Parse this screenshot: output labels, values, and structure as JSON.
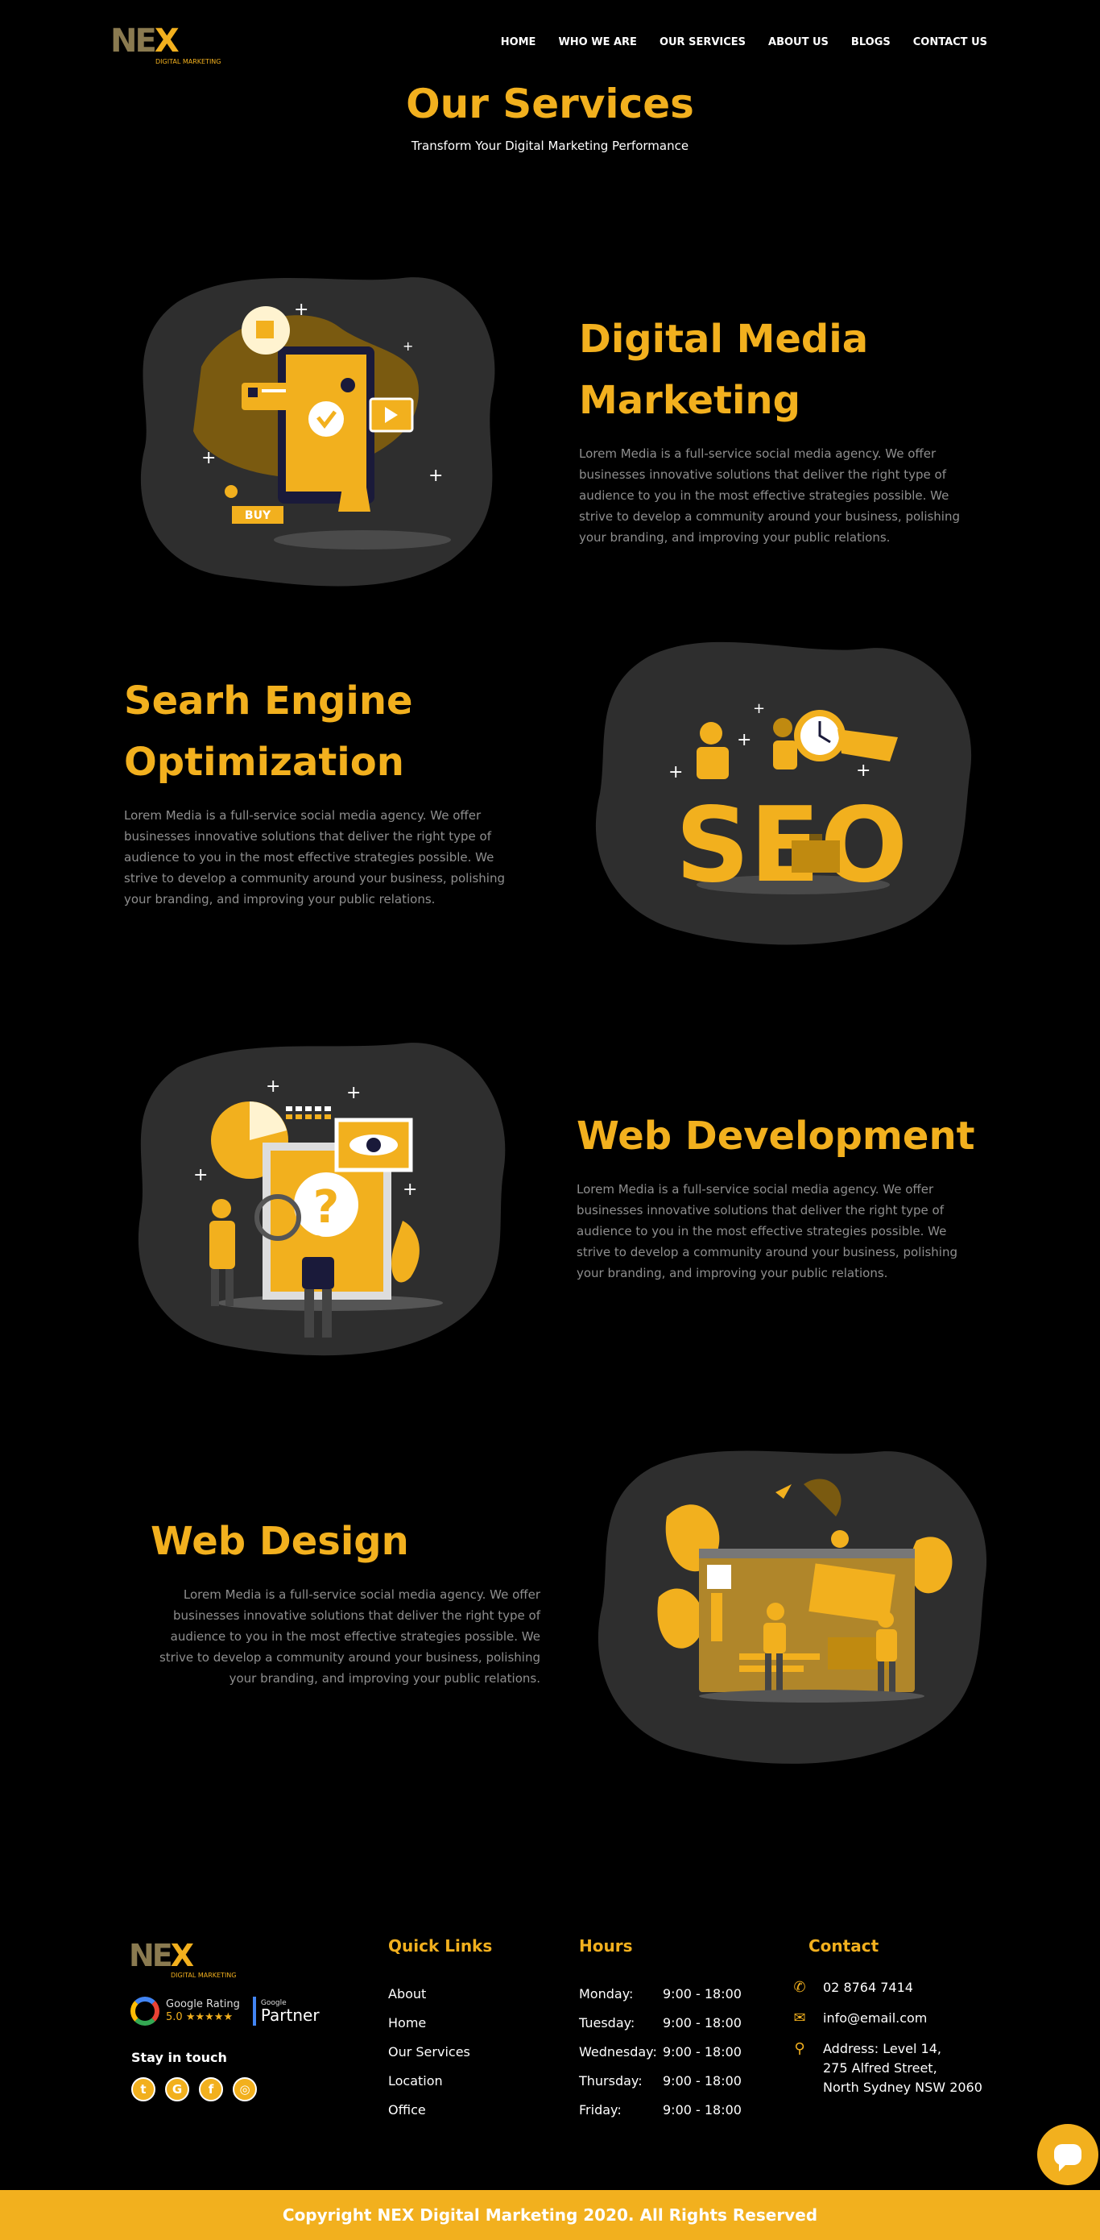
{
  "brand": {
    "logo_text": "NE",
    "logo_x": "X",
    "logo_sub": "DIGITAL MARKETING",
    "accent": "#f2b01e",
    "blob_color": "#2e2e2e"
  },
  "nav": {
    "items": [
      "HOME",
      "WHO WE ARE",
      "OUR SERVICES",
      "ABOUT US",
      "BLOGS",
      "CONTACT US"
    ]
  },
  "hero": {
    "title": "Our Services",
    "subtitle": "Transform Your Digital Marketing Performance"
  },
  "services": [
    {
      "title_line1": "Digital Media",
      "title_line2": "Marketing",
      "description": "Lorem Media is a full-service social media agency. We offer businesses innovative solutions that deliver the right type of audience to you in the most effective strategies possible. We strive to develop a community around your business, polishing your branding, and improving your public relations.",
      "illustration": "phone-marketing-illustration",
      "badge": "BUY"
    },
    {
      "title_line1": "Searh Engine",
      "title_line2": "Optimization",
      "description": "Lorem Media is a full-service social media agency. We offer businesses innovative solutions that deliver the right type of audience to you in the most effective strategies possible. We strive to develop a community around your business, polishing your branding, and improving your public relations.",
      "illustration": "seo-illustration",
      "badge": "SEO"
    },
    {
      "title_line1": "Web Development",
      "description": "Lorem Media is a full-service social media agency. We offer businesses innovative solutions that deliver the right type of audience to you in the most effective strategies possible. We strive to develop a community around your business, polishing your branding, and improving your public relations.",
      "illustration": "web-development-illustration",
      "badge": "?"
    },
    {
      "title_line1": "Web Design",
      "description": "Lorem Media is a full-service social media agency. We offer businesses innovative solutions that deliver the right type of audience to you in the most effective strategies possible. We strive to develop a community around your business, polishing your branding, and improving your public relations.",
      "illustration": "web-design-illustration"
    }
  ],
  "footer": {
    "google_rating_label": "Google Rating",
    "google_rating_value": "5.0",
    "stars": "★★★★★",
    "partner_small": "Google",
    "partner_label": "Partner",
    "stay_in_touch": "Stay in touch",
    "socials": [
      {
        "name": "twitter-icon",
        "glyph": "t"
      },
      {
        "name": "google-icon",
        "glyph": "G"
      },
      {
        "name": "facebook-icon",
        "glyph": "f"
      },
      {
        "name": "instagram-icon",
        "glyph": "◎"
      }
    ],
    "quick_links_title": "Quick Links",
    "quick_links": [
      "About",
      "Home",
      "Our Services",
      "Location",
      "Office"
    ],
    "hours_title": "Hours",
    "hours": [
      {
        "day": "Monday:",
        "time": "9:00 - 18:00"
      },
      {
        "day": "Tuesday:",
        "time": "9:00 - 18:00"
      },
      {
        "day": "Wednesday:",
        "time": "9:00 - 18:00"
      },
      {
        "day": "Thursday:",
        "time": "9:00 - 18:00"
      },
      {
        "day": "Friday:",
        "time": "9:00 - 18:00"
      }
    ],
    "contact_title": "Contact",
    "phone": "02 8764 7414",
    "email": "info@email.com",
    "address_line1": "Address: Level 14,",
    "address_line2": "275 Alfred Street,",
    "address_line3": "North Sydney NSW 2060",
    "copyright": "Copyright NEX Digital Marketing 2020. All Rights Reserved"
  }
}
